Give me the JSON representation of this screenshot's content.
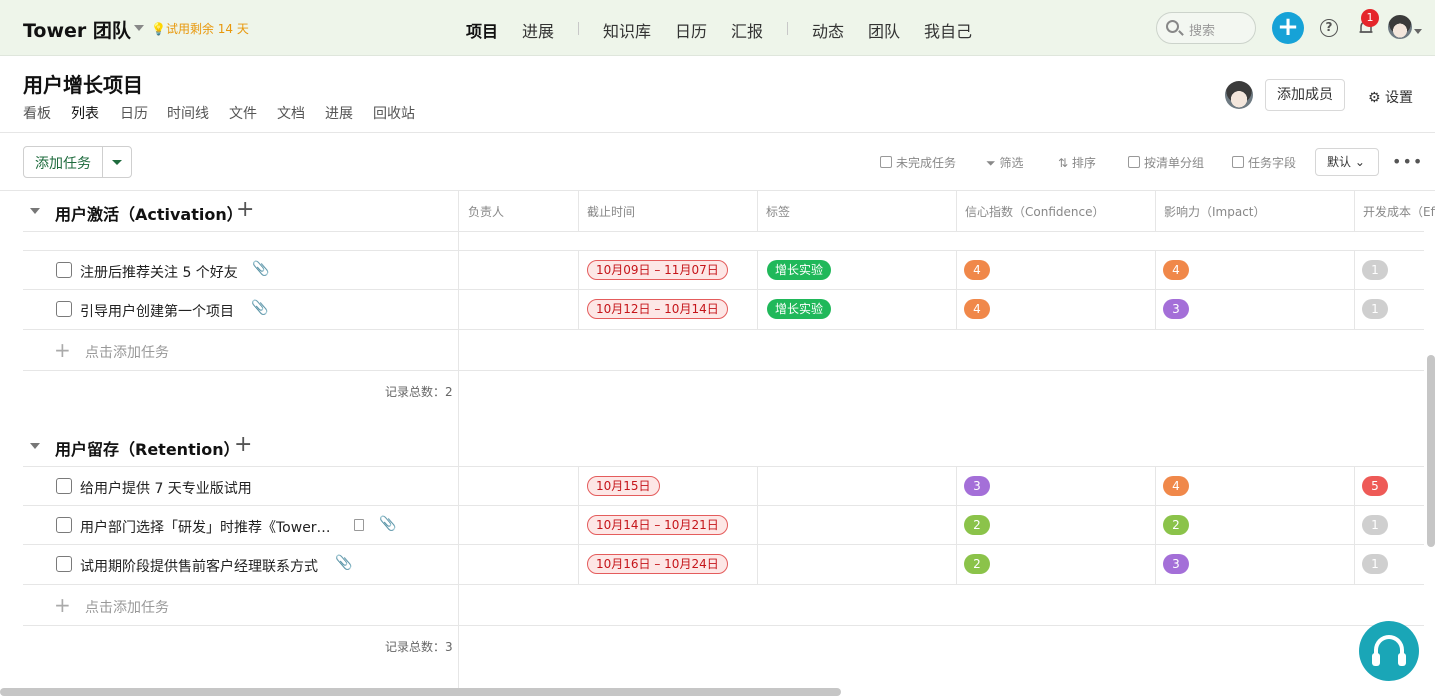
{
  "topbar": {
    "brand": "Tower 团队",
    "trial": "💡试用剩余 14 天",
    "nav": [
      "项目",
      "进展",
      "知识库",
      "日历",
      "汇报",
      "动态",
      "团队",
      "我自己"
    ],
    "search_placeholder": "搜索",
    "notification_count": "1"
  },
  "project": {
    "title": "用户增长项目",
    "tabs": [
      "看板",
      "列表",
      "日历",
      "时间线",
      "文件",
      "文档",
      "进展",
      "回收站"
    ],
    "active_tab": "列表",
    "add_member": "添加成员",
    "settings": "设置"
  },
  "toolbar": {
    "add_task": "添加任务",
    "incomplete": "未完成任务",
    "filter": "筛选",
    "sort": "排序",
    "group": "按清单分组",
    "fields": "任务字段",
    "default": "默认"
  },
  "columns": [
    "负责人",
    "截止时间",
    "标签",
    "信心指数（Confidence）",
    "影响力（Impact）",
    "开发成本（Eff"
  ],
  "colors": {
    "orange": "#f0884a",
    "purple": "#a46fd8",
    "gray": "#cfcfcf",
    "green": "#8bc34a",
    "red": "#ee5a57",
    "tag_green": "#20b85a"
  },
  "groups": [
    {
      "title": "用户激活（Activation）",
      "tasks": [
        {
          "name": "注册后推荐关注 5 个好友",
          "date": "10月09日 – 11月07日",
          "tag": "增长实验",
          "confidence": "4",
          "impact": "4",
          "effort": "1"
        },
        {
          "name": "引导用户创建第一个项目",
          "date": "10月12日 – 10月14日",
          "tag": "增长实验",
          "confidence": "4",
          "impact": "3",
          "effort": "1"
        }
      ],
      "add_label": "点击添加任务",
      "total": "记录总数：2"
    },
    {
      "title": "用户留存（Retention）",
      "tasks": [
        {
          "name": "给用户提供 7 天专业版试用",
          "date": "10月15日",
          "tag": "",
          "confidence": "3",
          "impact": "4",
          "effort": "5"
        },
        {
          "name": "用户部门选择「研发」时推荐《Tower…",
          "date": "10月14日 – 10月21日",
          "tag": "",
          "confidence": "2",
          "impact": "2",
          "effort": "1"
        },
        {
          "name": "试用期阶段提供售前客户经理联系方式",
          "date": "10月16日 – 10月24日",
          "tag": "",
          "confidence": "2",
          "impact": "3",
          "effort": "1"
        }
      ],
      "add_label": "点击添加任务",
      "total": "记录总数：3"
    }
  ]
}
